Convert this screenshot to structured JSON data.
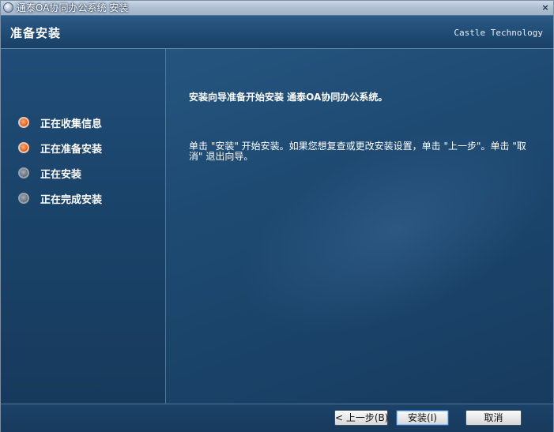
{
  "window": {
    "title": "通泰OA协同办公系统 安装",
    "close_label": "×"
  },
  "header": {
    "title": "准备安装",
    "brand": "Castle Technology"
  },
  "steps": [
    {
      "label": "正在收集信息",
      "state": "active"
    },
    {
      "label": "正在准备安装",
      "state": "active"
    },
    {
      "label": "正在安装",
      "state": "inactive"
    },
    {
      "label": "正在完成安装",
      "state": "inactive"
    }
  ],
  "main": {
    "headline": "安装向导准备开始安装 通泰OA协同办公系统。",
    "description": "单击 \"安装\" 开始安装。如果您想复查或更改安装设置，单击 \"上一步\"。单击 \"取消\" 退出向导。"
  },
  "buttons": {
    "back": "< 上一步(B)",
    "install": "安装(I)",
    "cancel": "取消"
  },
  "colors": {
    "active_step": "#ea6a2a",
    "inactive_step": "#6e767f",
    "panel_blue": "#1b446b"
  }
}
